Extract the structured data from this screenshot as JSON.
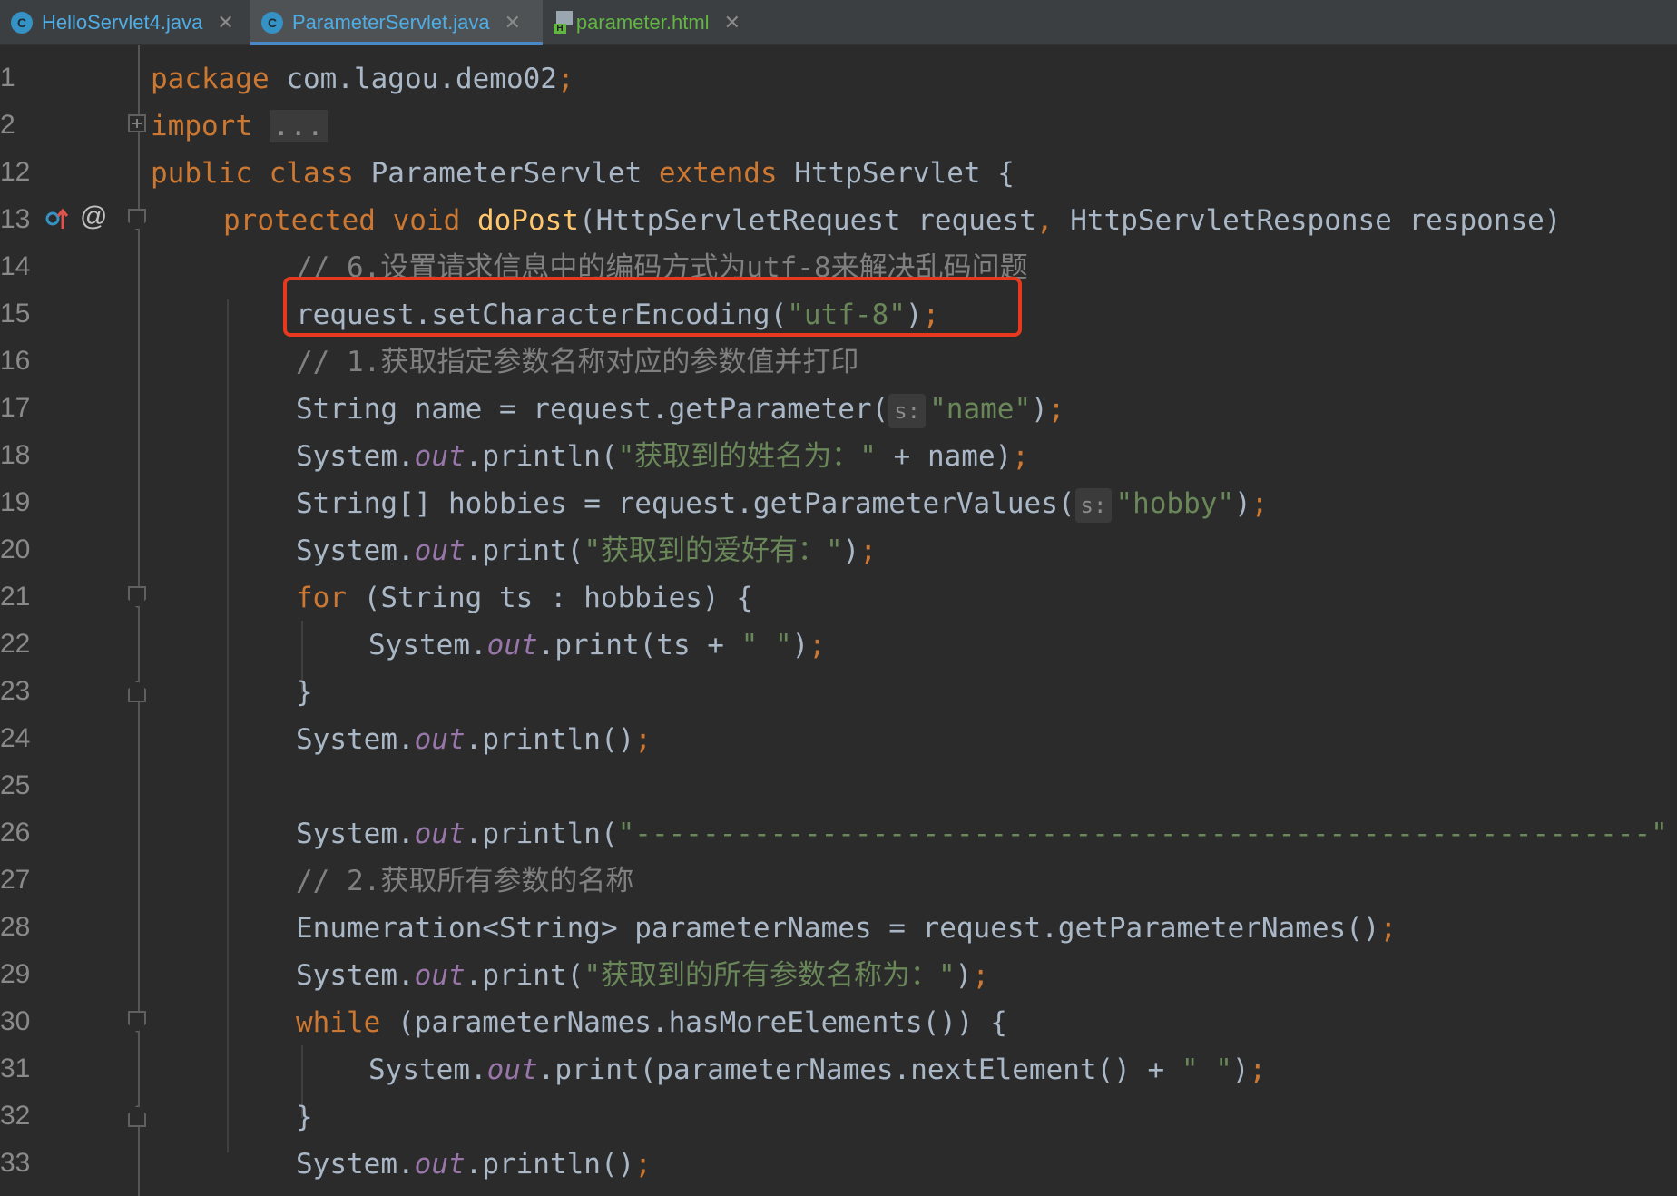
{
  "tabs": [
    {
      "label": "HelloServlet4.java",
      "icon": "java-class-icon",
      "close": "✕"
    },
    {
      "label": "ParameterServlet.java",
      "icon": "java-class-icon",
      "close": "✕",
      "active": true
    },
    {
      "label": "parameter.html",
      "icon": "html-file-icon",
      "close": "✕"
    }
  ],
  "icon_letters": {
    "class": "C",
    "html": "H"
  },
  "gutter": {
    "annotation": "@"
  },
  "lines": {
    "l1": {
      "num": "1",
      "a": "package",
      "b": " com.lagou.demo02",
      "c": ";"
    },
    "l2": {
      "num": "2",
      "a": "import",
      "b": " ",
      "c": "..."
    },
    "l12": {
      "num": "12",
      "a": "public class",
      "b": " ParameterServlet ",
      "c": "extends",
      "d": " HttpServlet {"
    },
    "l13": {
      "num": "13",
      "a": "protected void",
      "b": " ",
      "c": "doPost",
      "d": "(HttpServletRequest request",
      "e": ",",
      "f": " HttpServletResponse response)"
    },
    "l14": {
      "num": "14",
      "a": "// 6.设置请求信息中的编码方式为utf-8来解决乱码问题"
    },
    "l15": {
      "num": "15",
      "a": "request.setCharacterEncoding(",
      "b": "\"utf-8\"",
      "c": ")",
      "d": ";"
    },
    "l16": {
      "num": "16",
      "a": "// 1.获取指定参数名称对应的参数值并打印"
    },
    "l17": {
      "num": "17",
      "a": "String name = request.getParameter(",
      "hint": "s:",
      "b": "\"name\"",
      "c": ")",
      "d": ";"
    },
    "l18": {
      "num": "18",
      "a": "System.",
      "b": "out",
      "c": ".println(",
      "d": "\"获取到的姓名为：\"",
      "e": " + name)",
      "f": ";"
    },
    "l19": {
      "num": "19",
      "a": "String[] hobbies = request.getParameterValues(",
      "hint": "s:",
      "b": "\"hobby\"",
      "c": ")",
      "d": ";"
    },
    "l20": {
      "num": "20",
      "a": "System.",
      "b": "out",
      "c": ".print(",
      "d": "\"获取到的爱好有：\"",
      "e": ")",
      "f": ";"
    },
    "l21": {
      "num": "21",
      "a": "for",
      "b": " (String ts : hobbies) {"
    },
    "l22": {
      "num": "22",
      "a": "System.",
      "b": "out",
      "c": ".print(ts + ",
      "d": "\" \"",
      "e": ")",
      "f": ";"
    },
    "l23": {
      "num": "23",
      "a": "}"
    },
    "l24": {
      "num": "24",
      "a": "System.",
      "b": "out",
      "c": ".println()",
      "d": ";"
    },
    "l25": {
      "num": "25"
    },
    "l26": {
      "num": "26",
      "a": "System.",
      "b": "out",
      "c": ".println(",
      "d": "\"------------------------------------------------------------\""
    },
    "l27": {
      "num": "27",
      "a": "// 2.获取所有参数的名称"
    },
    "l28": {
      "num": "28",
      "a": "Enumeration<String> parameterNames = request.getParameterNames()",
      "b": ";"
    },
    "l29": {
      "num": "29",
      "a": "System.",
      "b": "out",
      "c": ".print(",
      "d": "\"获取到的所有参数名称为：\"",
      "e": ")",
      "f": ";"
    },
    "l30": {
      "num": "30",
      "a": "while",
      "b": " (parameterNames.hasMoreElements()) {"
    },
    "l31": {
      "num": "31",
      "a": "System.",
      "b": "out",
      "c": ".print(parameterNames.nextElement() + ",
      "d": "\" \"",
      "e": ")",
      "f": ";"
    },
    "l32": {
      "num": "32",
      "a": "}"
    },
    "l33": {
      "num": "33",
      "a": "System.",
      "b": "out",
      "c": ".println()",
      "d": ";"
    }
  },
  "colors": {
    "keyword": "#cc7832",
    "method": "#ffc66d",
    "string": "#6a8759",
    "comment": "#808080",
    "field": "#9876aa",
    "highlight_box": "#e8391e"
  }
}
